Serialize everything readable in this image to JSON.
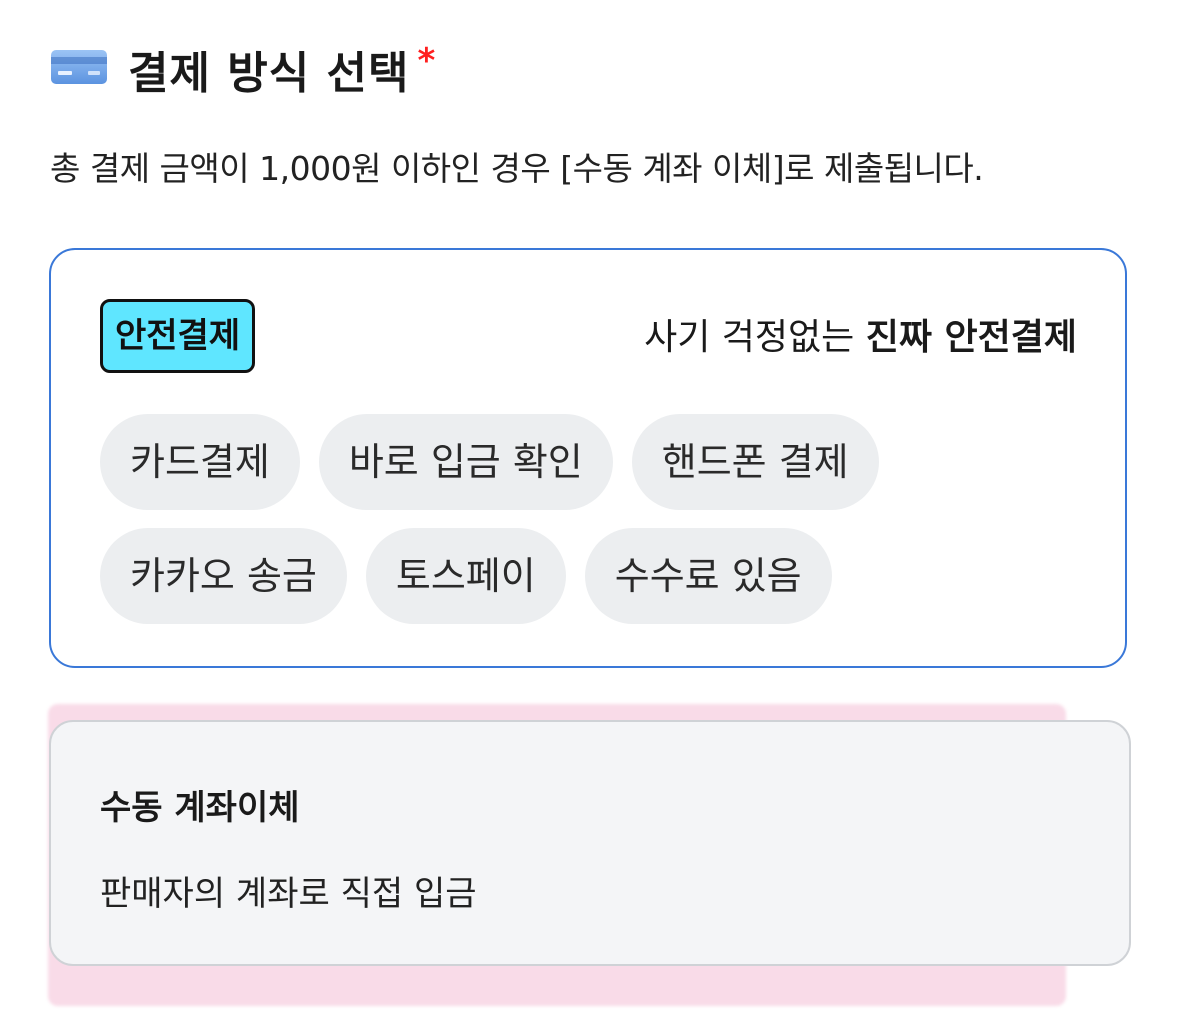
{
  "header": {
    "icon": "credit-card-icon",
    "title": "결제 방식 선택",
    "required_mark": "*",
    "required_color": "#ff1f1f"
  },
  "notice": "총 결제 금액이 1,000원 이하인 경우 [수동 계좌 이체]로 제출됩니다.",
  "safe_payment": {
    "badge": "안전결제",
    "badge_color": "#5fe6ff",
    "tagline_prefix": "사기 걱정없는 ",
    "tagline_strong": "진짜 안전결제",
    "border_color": "#3a78d8",
    "chips_row1": [
      "카드결제",
      "바로 입금 확인",
      "핸드폰 결제"
    ],
    "chips_row2": [
      "카카오 송금",
      "토스페이",
      "수수료 있음"
    ]
  },
  "manual_transfer": {
    "title": "수동 계좌이체",
    "description": "판매자의 계좌로 직접 입금",
    "highlight_color": "#f9dbe8"
  }
}
